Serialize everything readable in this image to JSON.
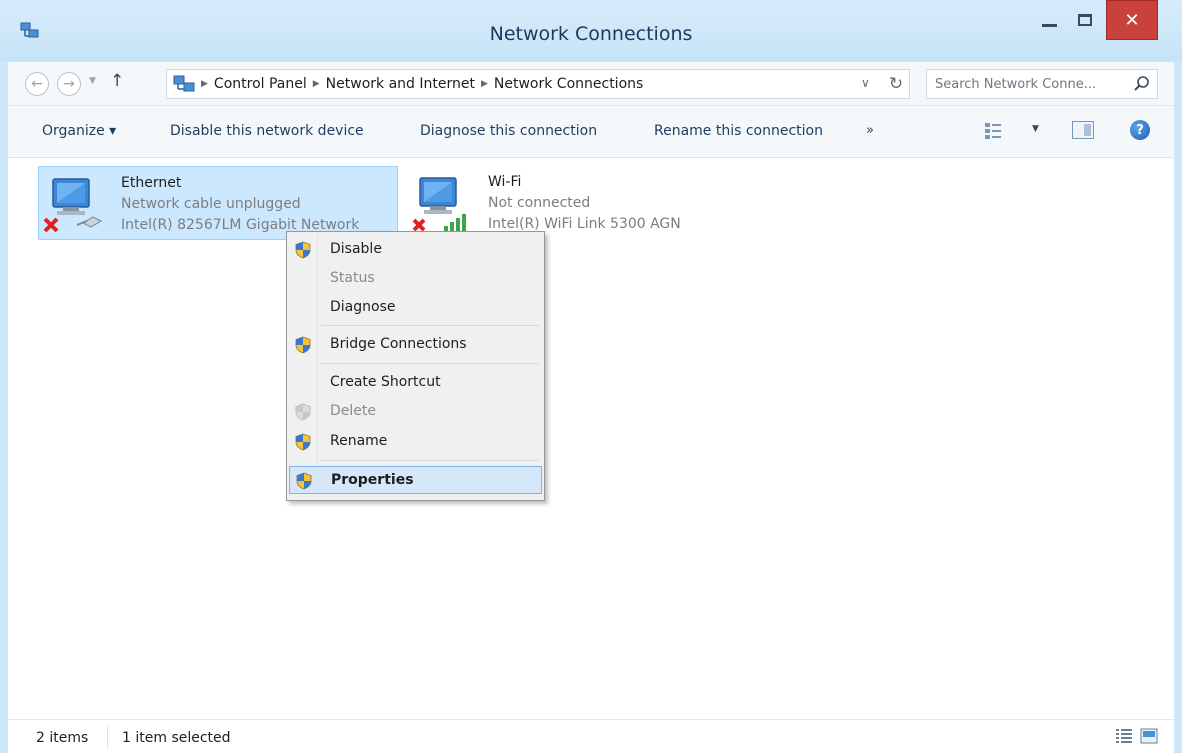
{
  "window": {
    "title": "Network Connections",
    "close_glyph": "✕"
  },
  "address_bar": {
    "crumbs": [
      "Control Panel",
      "Network and Internet",
      "Network Connections"
    ],
    "search_placeholder": "Search Network Conne..."
  },
  "toolbar": {
    "organize": "Organize ▾",
    "disable": "Disable this network device",
    "diagnose": "Diagnose this connection",
    "rename": "Rename this connection",
    "more": "»",
    "help": "?"
  },
  "connections": [
    {
      "name": "Ethernet",
      "status": "Network cable unplugged",
      "device": "Intel(R) 82567LM Gigabit Network",
      "selected": true,
      "icon": "ethernet-disconnected-icon"
    },
    {
      "name": "Wi-Fi",
      "status": "Not connected",
      "device": "Intel(R) WiFi Link 5300 AGN",
      "selected": false,
      "icon": "wifi-disconnected-icon"
    }
  ],
  "context_menu": {
    "items": [
      {
        "label": "Disable",
        "shield": true,
        "disabled": false
      },
      {
        "label": "Status",
        "shield": false,
        "disabled": true
      },
      {
        "label": "Diagnose",
        "shield": false,
        "disabled": false
      },
      {
        "label": "Bridge Connections",
        "shield": true,
        "disabled": false
      },
      {
        "label": "Create Shortcut",
        "shield": false,
        "disabled": false
      },
      {
        "label": "Delete",
        "shield": true,
        "disabled": true
      },
      {
        "label": "Rename",
        "shield": true,
        "disabled": false
      },
      {
        "label": "Properties",
        "shield": true,
        "disabled": false,
        "bold": true,
        "highlighted": true
      }
    ]
  },
  "status_bar": {
    "item_count": "2 items",
    "selection": "1 item selected"
  },
  "colors": {
    "frame": "#cde8fb",
    "selection_fill": "#cce8ff",
    "close_button": "#c9413b"
  }
}
